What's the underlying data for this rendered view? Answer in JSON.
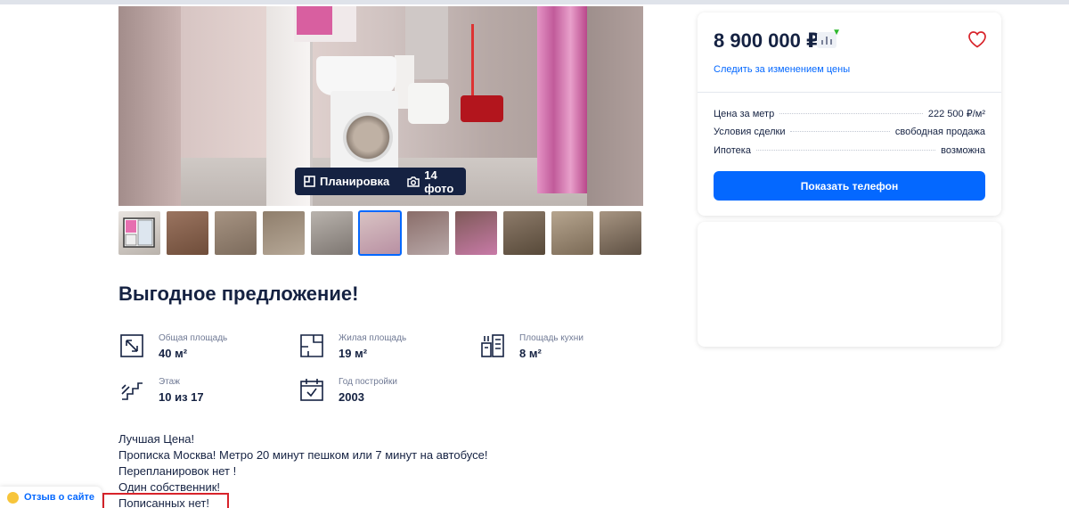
{
  "gallery": {
    "layout_label": "Планировка",
    "photos_label": "14 фото",
    "thumbnails": [
      {
        "colors": [
          "#e9e4e0",
          "#b9b2ab"
        ],
        "kind": "plan"
      },
      {
        "colors": [
          "#9a7460",
          "#6f4d3a"
        ]
      },
      {
        "colors": [
          "#a69382",
          "#7c6b5c"
        ]
      },
      {
        "colors": [
          "#8f7e6c",
          "#b6a897"
        ]
      },
      {
        "colors": [
          "#b9b3ad",
          "#7d7671"
        ]
      },
      {
        "colors": [
          "#d9c4c4",
          "#b88fa2"
        ],
        "active": true
      },
      {
        "colors": [
          "#8a6d69",
          "#b8a8a8"
        ]
      },
      {
        "colors": [
          "#7e5a58",
          "#c87aa7"
        ]
      },
      {
        "colors": [
          "#8d7b6a",
          "#574939"
        ]
      },
      {
        "colors": [
          "#b6a58f",
          "#7b6a56"
        ]
      },
      {
        "colors": [
          "#a79582",
          "#5e5043"
        ]
      }
    ]
  },
  "headline": "Выгодное предложение!",
  "params": [
    {
      "icon": "total-area-icon",
      "label": "Общая площадь",
      "value": "40 м²"
    },
    {
      "icon": "living-area-icon",
      "label": "Жилая площадь",
      "value": "19 м²"
    },
    {
      "icon": "kitchen-area-icon",
      "label": "Площадь кухни",
      "value": "8 м²"
    },
    {
      "icon": "floor-icon",
      "label": "Этаж",
      "value": "10 из 17"
    },
    {
      "icon": "calendar-icon",
      "label": "Год постройки",
      "value": "2003"
    }
  ],
  "description": [
    "Лучшая Цена!",
    "Прописка Москва! Метро 20 минут пешком или 7 минут на автобусе!",
    "Перепланировок нет !",
    "Один собственник!",
    "Пописанных нет!"
  ],
  "feedback_label": "Отзыв о сайте",
  "offer": {
    "price": "8 900 000 ₽",
    "follow_label": "Следить за изменением цены",
    "rows": [
      {
        "label": "Цена за метр",
        "value": "222 500 ₽/м²"
      },
      {
        "label": "Условия сделки",
        "value": "свободная продажа"
      },
      {
        "label": "Ипотека",
        "value": "возможна"
      }
    ],
    "phone_button": "Показать телефон"
  },
  "colors": {
    "accent": "#0468ff",
    "text": "#152242",
    "muted": "#707a95",
    "price_down": "#2eb82e",
    "highlight": "#d8232a"
  }
}
